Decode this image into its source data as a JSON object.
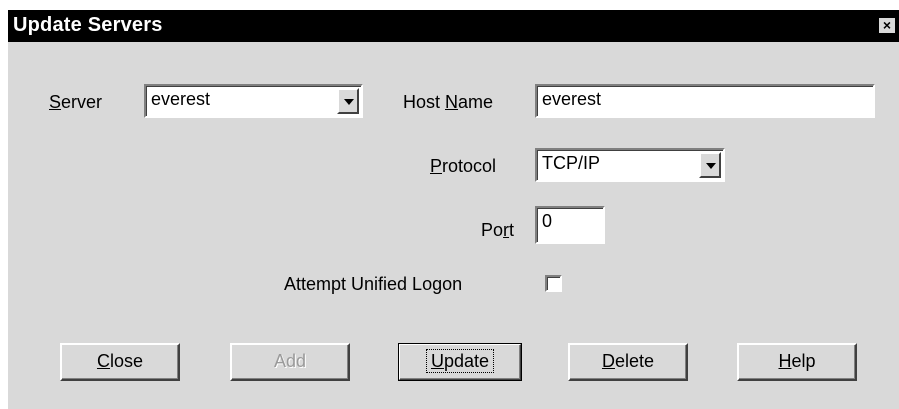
{
  "window": {
    "title": "Update Servers",
    "close_glyph": "×"
  },
  "form": {
    "server": {
      "label_prefix": "",
      "label_key": "S",
      "label_rest": "erver",
      "value": "everest"
    },
    "host_name": {
      "label_prefix": "Host ",
      "label_key": "N",
      "label_rest": "ame",
      "value": "everest"
    },
    "protocol": {
      "label_prefix": "",
      "label_key": "P",
      "label_rest": "rotocol",
      "value": "TCP/IP"
    },
    "port": {
      "label_prefix": "Po",
      "label_key": "r",
      "label_rest": "t",
      "value": "0"
    },
    "unified_logon": {
      "label": "Attempt Unified Logon",
      "checked": false
    }
  },
  "buttons": {
    "close": {
      "key": "C",
      "rest": "lose"
    },
    "add": {
      "key": "",
      "rest": "Add",
      "disabled": true
    },
    "update": {
      "key": "U",
      "rest": "pdate",
      "default": true
    },
    "delete": {
      "key": "D",
      "rest": "elete"
    },
    "help": {
      "key": "H",
      "rest": "elp"
    }
  },
  "colors": {
    "titlebar": "#000000",
    "dialog_face": "#d9d9d9"
  }
}
